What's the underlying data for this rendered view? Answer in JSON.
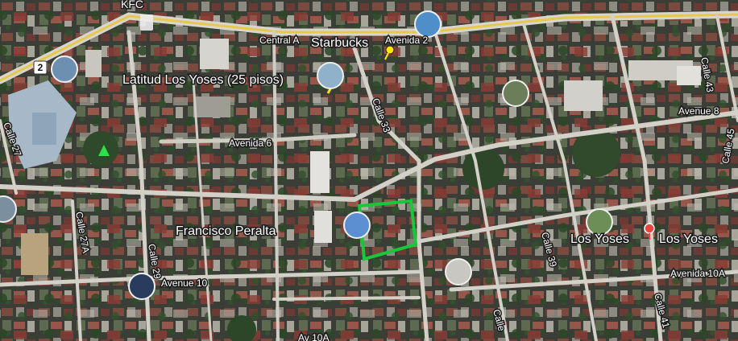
{
  "map": {
    "places": {
      "kfc": "KFC",
      "starbucks": "Starbucks",
      "latitud": "Latitud Los Yoses (25 pisos)",
      "francisco": "Francisco Peralta",
      "los_yoses_1": "Los Yoses",
      "los_yoses_2": "Los Yoses"
    },
    "roads": {
      "central": "Central A",
      "avenida2": "Avenida 2",
      "avenida6": "Avenida 6",
      "avenida8": "Avenue 8",
      "avenida10": "Avenue 10",
      "avenida10a": "Avenida 10A",
      "av10a_bottom": "Av 10A",
      "calle33": "Calle 33",
      "calle39": "Calle 39",
      "calle41": "Calle 41",
      "calle43": "Calle 43",
      "calle45": "Calle 45",
      "calle29": "Calle 29",
      "calle27a": "Calle 27A",
      "calle27": "Calle 27",
      "calle_bottom": "Calle"
    },
    "badge_number": "2",
    "colors": {
      "highlight_polygon": "#19c73a",
      "road": "#d8d6cf",
      "highway": "#e6c84c",
      "pin": "#ffe600",
      "marker_red": "#e8453c"
    }
  }
}
